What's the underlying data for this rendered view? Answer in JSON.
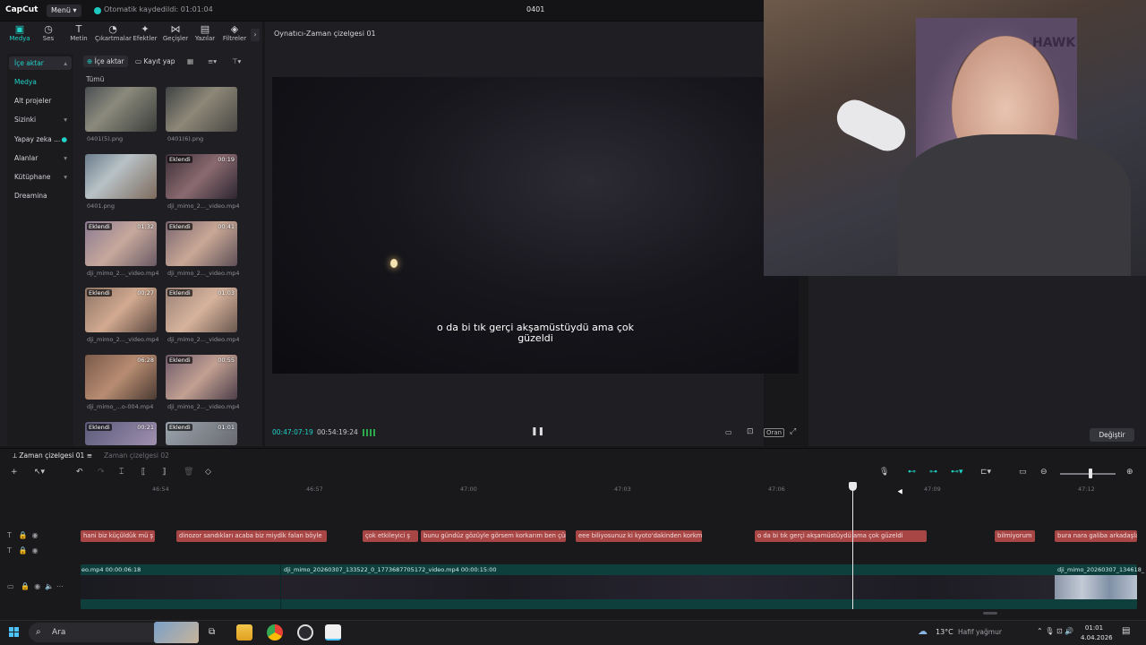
{
  "app": {
    "logo": "CapCut",
    "menu": "Menü",
    "autosave": "Otomatik kaydedildi: 01:01:04",
    "project_title": "0401"
  },
  "tools": [
    {
      "label": "Medya",
      "icon": "media-icon"
    },
    {
      "label": "Ses",
      "icon": "audio-icon"
    },
    {
      "label": "Metin",
      "icon": "text-icon"
    },
    {
      "label": "Çıkartmalar",
      "icon": "sticker-icon"
    },
    {
      "label": "Efektler",
      "icon": "effects-icon"
    },
    {
      "label": "Geçişler",
      "icon": "transition-icon"
    },
    {
      "label": "Yazılar",
      "icon": "captions-icon"
    },
    {
      "label": "Filtreler",
      "icon": "filter-icon"
    }
  ],
  "categories": [
    {
      "label": "İçe aktar",
      "active": true
    },
    {
      "label": "Medya"
    },
    {
      "label": "Alt projeler"
    },
    {
      "label": "Sizinki"
    },
    {
      "label": "Yapay zeka ..."
    },
    {
      "label": "Alanlar"
    },
    {
      "label": "Kütüphane"
    },
    {
      "label": "Dreamina"
    }
  ],
  "media_toolbar": {
    "import": "İçe aktar",
    "record": "Kayıt yap",
    "filter_all": "Tümü"
  },
  "media": [
    {
      "name": "0401(5).png",
      "badge": "",
      "dur": ""
    },
    {
      "name": "0401(6).png",
      "badge": "",
      "dur": ""
    },
    {
      "name": "0401.png",
      "badge": "",
      "dur": ""
    },
    {
      "name": "dji_mimo_2..._video.mp4",
      "badge": "Eklendi",
      "dur": "00:19"
    },
    {
      "name": "dji_mimo_2..._video.mp4",
      "badge": "Eklendi",
      "dur": "01:32"
    },
    {
      "name": "dji_mimo_2..._video.mp4",
      "badge": "Eklendi",
      "dur": "00:41"
    },
    {
      "name": "dji_mimo_2..._video.mp4",
      "badge": "Eklendi",
      "dur": "00:27"
    },
    {
      "name": "dji_mimo_2..._video.mp4",
      "badge": "Eklendi",
      "dur": "01:03"
    },
    {
      "name": "dji_mimo_...o-004.mp4",
      "badge": "",
      "dur": "06:28"
    },
    {
      "name": "dji_mimo_2..._video.mp4",
      "badge": "Eklendi",
      "dur": "00:55"
    },
    {
      "name": "",
      "badge": "Eklendi",
      "dur": "00:21"
    },
    {
      "name": "",
      "badge": "Eklendi",
      "dur": "01:01"
    }
  ],
  "player": {
    "title": "Oynatıcı-Zaman çizelgesi 01",
    "subtitle_line1": "o da bi tık gerçi akşamüstüydü ama çok",
    "subtitle_line2": "güzeldi",
    "time_current": "00:47:07:19",
    "time_total": "00:54:19:24",
    "ratio_label": "Oran"
  },
  "right_panel": {
    "change_button": "Değiştir"
  },
  "timeline": {
    "tab_active": "Zaman çizelgesi 01",
    "tab_inactive": "Zaman çizelgesi 02",
    "ruler": [
      "46:54",
      "46:57",
      "47:00",
      "47:03",
      "47:06",
      "47:09",
      "47:12"
    ],
    "subtitles": [
      "hani biz küçüldük mü ş",
      "dinozor sandıkları acaba biz miydik falan böyle",
      "çok etkileyici ş",
      "bunu gündüz gözüyle görsem korkarım ben çün",
      "eee biliyosunuz ki kyoto'dakinden korkmu",
      "o da bi tık gerçi akşamüstüydü ama çok güzeldi",
      "bilmiyorum",
      "bura nara galiba arkadaşla"
    ],
    "video_labels": [
      "eo.mp4  00:00:06:18",
      "dji_mimo_20260307_133522_0_1773687705172_video.mp4  00:00:15:00",
      "dji_mimo_20260307_134618_"
    ]
  },
  "taskbar": {
    "search": "Ara",
    "weather": "13°C",
    "weather_desc": "Hafif yağmur",
    "time": "01:01",
    "date": "4.04.2026"
  },
  "colors": {
    "accent": "#20d3c8",
    "subtitle_clip": "#a84646",
    "video_clip": "#0f3f3c"
  }
}
